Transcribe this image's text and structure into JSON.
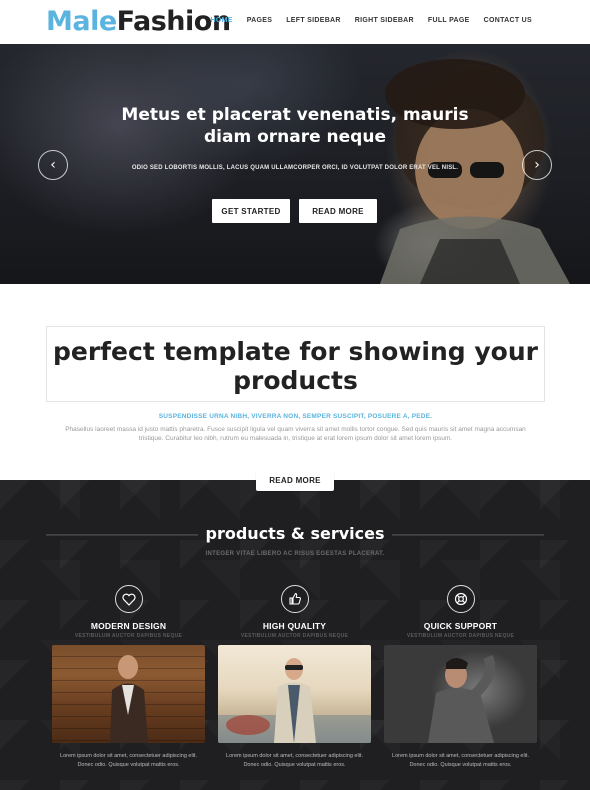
{
  "brand": {
    "part1": "Male",
    "part2": "Fashion"
  },
  "nav": [
    "HOME",
    "PAGES",
    "LEFT SIDEBAR",
    "RIGHT SIDEBAR",
    "FULL PAGE",
    "CONTACT US"
  ],
  "hero": {
    "title": "Metus et placerat venenatis, mauris diam ornare neque",
    "subtitle": "ODIO SED LOBORTIS MOLLIS, LACUS QUAM ULLAMCORPER ORCI, ID VOLUTPAT DOLOR ERAT VEL NISL.",
    "btn_primary": "GET STARTED",
    "btn_secondary": "READ MORE",
    "prev_icon": "‹",
    "next_icon": "›"
  },
  "intro": {
    "title": "perfect template for showing your products",
    "kicker": "SUSPENDISSE URNA NIBH, VIVERRA NON, SEMPER SUSCIPIT, POSUERE A, PEDE.",
    "text": "Phasellus laoreet massa id justo mattis pharetra. Fusce suscipit ligula vel quam viverra sit amet mollis tortor congue. Sed quis mauris sit amet magna accumsan tristique. Curabitur leo nibh, rutrum eu malesuada in, tristique at erat lorem ipsum dolor sit amet lorem ipsum.",
    "read_more": "READ MORE"
  },
  "services": {
    "title": "products & services",
    "subtitle": "INTEGER VITAE LIBERO AC RISUS EGESTAS PLACERAT.",
    "items": [
      {
        "icon": "heart-icon",
        "title": "MODERN DESIGN",
        "sub": "VESTIBULUM AUCTOR DAPIBUS NEQUE",
        "desc": "Lorem ipsum dolor sit amet, consectetuer adipiscing elit. Donec odio. Quisque volutpat mattis eros."
      },
      {
        "icon": "thumbs-up-icon",
        "title": "HIGH QUALITY",
        "sub": "VESTIBULUM AUCTOR DAPIBUS NEQUE",
        "desc": "Lorem ipsum dolor sit amet, consectetuer adipiscing elit. Donec odio. Quisque volutpat mattis eros."
      },
      {
        "icon": "lifebuoy-icon",
        "title": "QUICK SUPPORT",
        "sub": "VESTIBULUM AUCTOR DAPIBUS NEQUE",
        "desc": "Lorem ipsum dolor sit amet, consectetuer adipiscing elit. Donec odio. Quisque volutpat mattis eros."
      }
    ]
  },
  "colors": {
    "accent": "#5ab4df",
    "dark_bg": "#1f1f21"
  }
}
